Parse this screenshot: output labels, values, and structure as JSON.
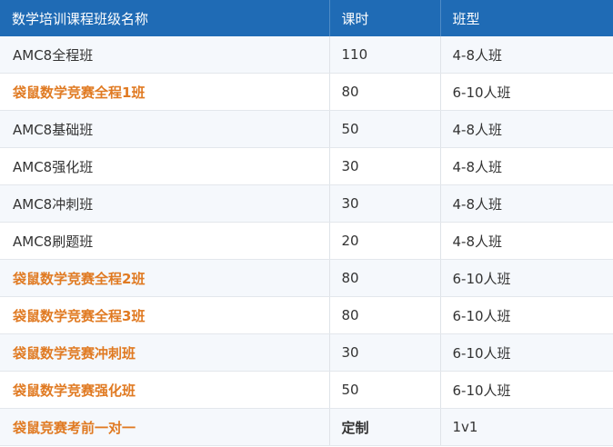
{
  "table": {
    "headers": [
      "数学培训课程班级名称",
      "课时",
      "班型"
    ],
    "rows": [
      {
        "name": "AMC8全程班",
        "hours": "110",
        "type": "4-8人班",
        "highlight": false
      },
      {
        "name": "袋鼠数学竞赛全程1班",
        "hours": "80",
        "type": "6-10人班",
        "highlight": true
      },
      {
        "name": "AMC8基础班",
        "hours": "50",
        "type": "4-8人班",
        "highlight": false
      },
      {
        "name": "AMC8强化班",
        "hours": "30",
        "type": "4-8人班",
        "highlight": false
      },
      {
        "name": "AMC8冲刺班",
        "hours": "30",
        "type": "4-8人班",
        "highlight": false
      },
      {
        "name": "AMC8刷题班",
        "hours": "20",
        "type": "4-8人班",
        "highlight": false
      },
      {
        "name": "袋鼠数学竞赛全程2班",
        "hours": "80",
        "type": "6-10人班",
        "highlight": true
      },
      {
        "name": "袋鼠数学竞赛全程3班",
        "hours": "80",
        "type": "6-10人班",
        "highlight": true
      },
      {
        "name": "袋鼠数学竞赛冲刺班",
        "hours": "30",
        "type": "6-10人班",
        "highlight": true
      },
      {
        "name": "袋鼠数学竞赛强化班",
        "hours": "50",
        "type": "6-10人班",
        "highlight": true
      },
      {
        "name": "袋鼠竞赛考前一对一",
        "hours": "定制",
        "type": "1v1",
        "highlight": true
      }
    ]
  },
  "colors": {
    "header_bg": "#1f6bb5",
    "highlight_text": "#e07a22",
    "row_alt_bg": "#f5f8fc"
  }
}
